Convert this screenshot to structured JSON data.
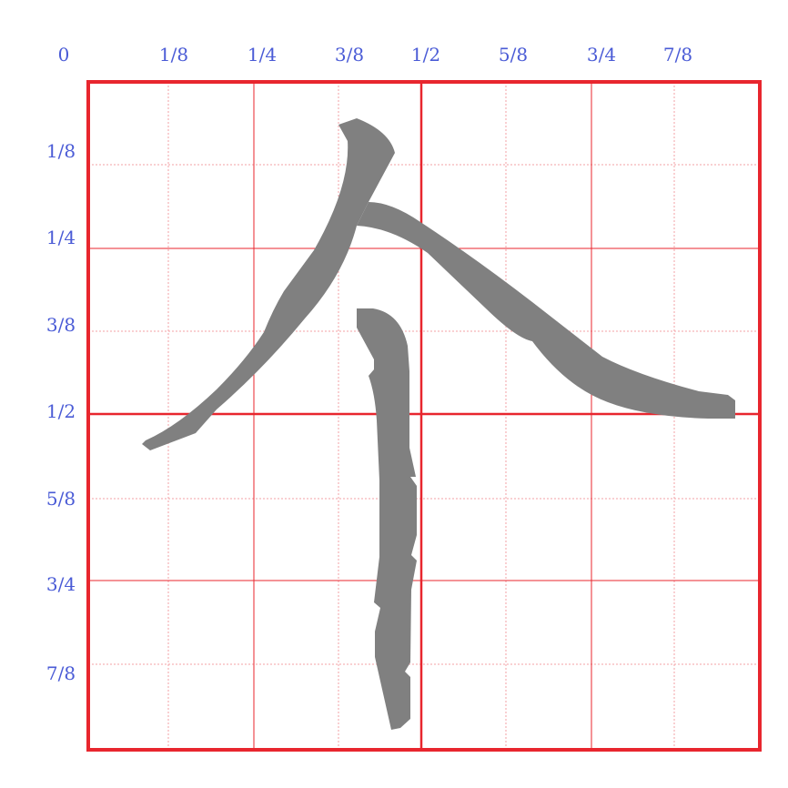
{
  "top_labels": [
    "0",
    "1/8",
    "1/4",
    "3/8",
    "1/2",
    "5/8",
    "3/4",
    "7/8"
  ],
  "left_labels": [
    "1/8",
    "1/4",
    "3/8",
    "1/2",
    "5/8",
    "3/4",
    "7/8"
  ],
  "colors": {
    "frame": "#e8262e",
    "grid_major": "#e8262e",
    "grid_minor": "#f3a0a4",
    "label": "#4a5bd6",
    "glyph": "#808080"
  }
}
